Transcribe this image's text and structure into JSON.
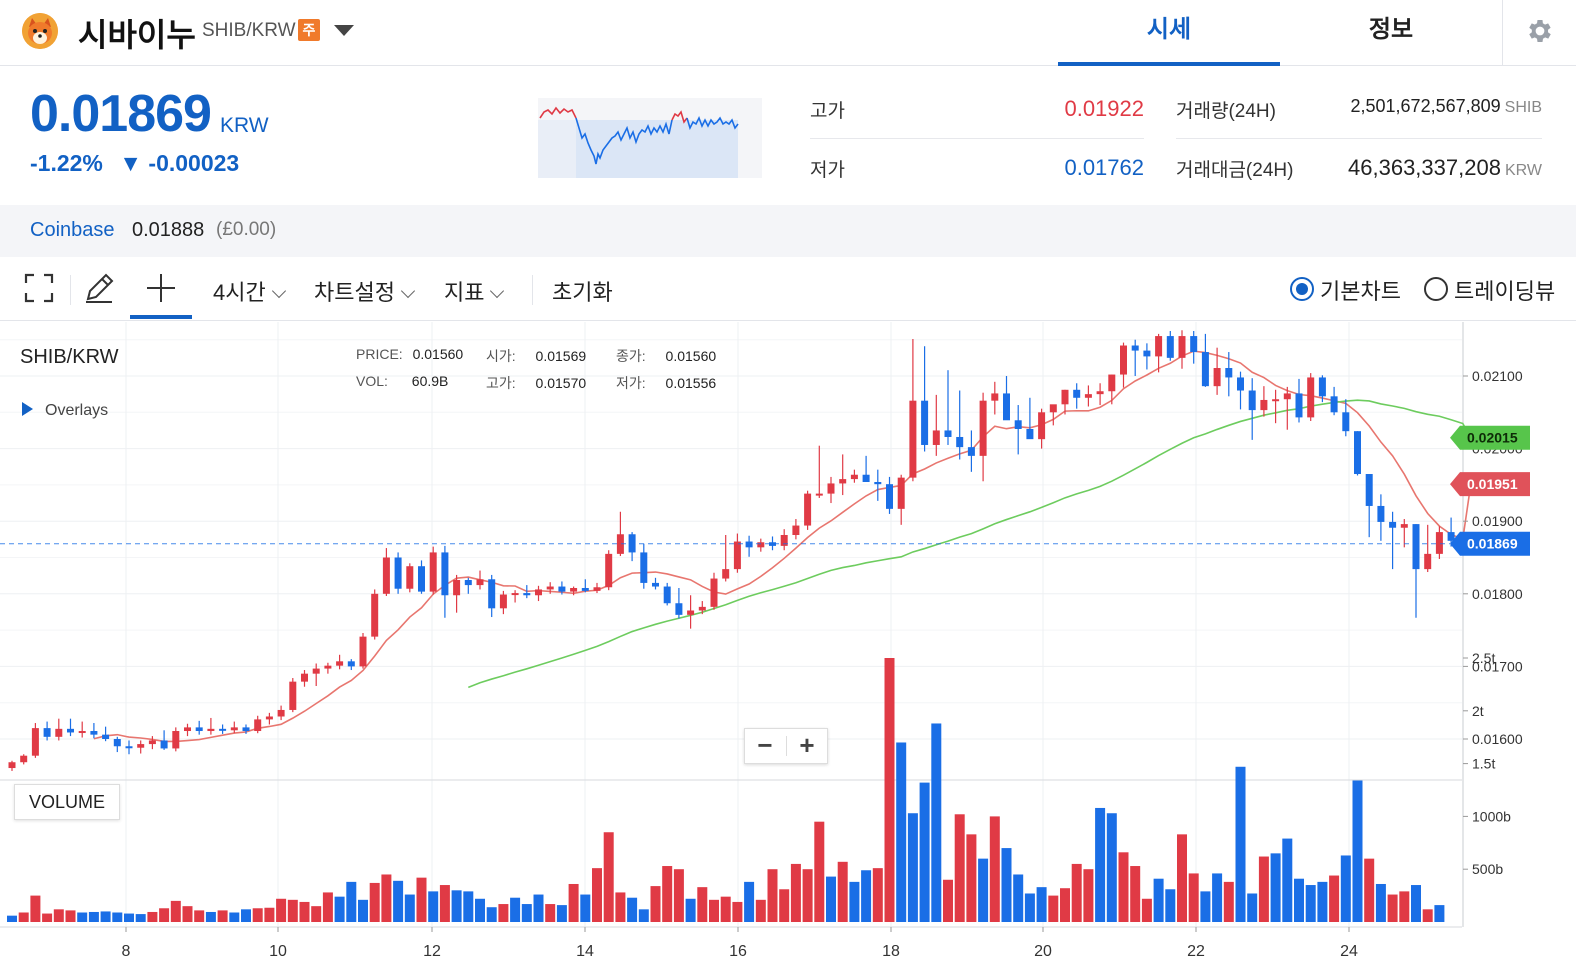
{
  "header": {
    "coin_name": "시바이누",
    "pair": "SHIB/KRW",
    "warning_badge": "주",
    "tabs": [
      {
        "label": "시세",
        "active": true
      },
      {
        "label": "정보",
        "active": false
      }
    ],
    "icons": {
      "logo": "shiba-inu-logo",
      "dropdown": "chevron-down-icon",
      "settings": "gear-icon"
    }
  },
  "summary": {
    "price": "0.01869",
    "unit": "KRW",
    "change_rate": "-1.22%",
    "change_arrow": "▼",
    "change_amount": "-0.00023",
    "high_label": "고가",
    "high_value": "0.01922",
    "low_label": "저가",
    "low_value": "0.01762",
    "volume_label": "거래량(24H)",
    "volume_value": "2,501,672,567,809",
    "volume_unit": "SHIB",
    "amount_label": "거래대금(24H)",
    "amount_value": "46,363,337,208",
    "amount_unit": "KRW"
  },
  "coinbase": {
    "label": "Coinbase",
    "value": "0.01888",
    "sub": "(£0.00)"
  },
  "toolbar": {
    "interval": "4시간",
    "chart_settings": "차트설정",
    "indicators": "지표",
    "reset": "초기화",
    "mode_basic": "기본차트",
    "mode_tradingview": "트레이딩뷰",
    "selected_mode": "기본차트",
    "icons": [
      "fullscreen-icon",
      "pencil-icon",
      "crosshair-icon"
    ]
  },
  "chart": {
    "symbol": "SHIB/KRW",
    "overlays_label": "Overlays",
    "ohlc": {
      "price_label": "PRICE:",
      "price": "0.01560",
      "open_label": "시가:",
      "open": "0.01569",
      "close_label": "종가:",
      "close": "0.01560",
      "vol_label": "VOL:",
      "vol": "60.9B",
      "high_label": "고가:",
      "high": "0.01570",
      "low_label": "저가:",
      "low": "0.01556"
    },
    "zoom_out": "−",
    "zoom_in": "+",
    "volume_label": "VOLUME",
    "colors": {
      "up": "#e03a45",
      "down": "#1a6ee6",
      "ma_short": "#e8766f",
      "ma_long": "#6dcc5e",
      "price_line": "#1a6ee6"
    }
  },
  "chart_data": {
    "type": "candlestick",
    "x_tick_labels": [
      "8",
      "10",
      "12",
      "14",
      "16",
      "18",
      "20",
      "22",
      "24"
    ],
    "y_tick_labels": [
      "0.02100",
      "0.02000",
      "0.01900",
      "0.01800",
      "0.01700",
      "0.01600"
    ],
    "volume_tick_labels": [
      "2.5t",
      "2t",
      "1.5t",
      "1000b",
      "500b"
    ],
    "price_markers": [
      {
        "label": "0.02015",
        "value": 0.02015,
        "color": "#57c54b"
      },
      {
        "label": "0.01951",
        "value": 0.01951,
        "color": "#e0525a"
      },
      {
        "label": "0.01869",
        "value": 0.01869,
        "color": "#1a6ee6"
      }
    ],
    "candles": [
      [
        0.0156,
        0.0157,
        0.01556,
        0.01568
      ],
      [
        0.01568,
        0.01579,
        0.01565,
        0.01577
      ],
      [
        0.01577,
        0.01622,
        0.01574,
        0.01615
      ],
      [
        0.01615,
        0.01624,
        0.01598,
        0.01603
      ],
      [
        0.01603,
        0.01628,
        0.01598,
        0.01614
      ],
      [
        0.01614,
        0.01628,
        0.01604,
        0.01609
      ],
      [
        0.01609,
        0.01624,
        0.01602,
        0.01611
      ],
      [
        0.01611,
        0.01622,
        0.01601,
        0.01606
      ],
      [
        0.01606,
        0.01617,
        0.01597,
        0.016
      ],
      [
        0.016,
        0.01603,
        0.01582,
        0.0159
      ],
      [
        0.0159,
        0.01598,
        0.01579,
        0.01588
      ],
      [
        0.01588,
        0.01598,
        0.0158,
        0.01593
      ],
      [
        0.01593,
        0.01604,
        0.01586,
        0.01598
      ],
      [
        0.01598,
        0.01612,
        0.01585,
        0.01587
      ],
      [
        0.01587,
        0.01616,
        0.01583,
        0.01611
      ],
      [
        0.01611,
        0.01621,
        0.01604,
        0.01616
      ],
      [
        0.01616,
        0.01625,
        0.01606,
        0.01611
      ],
      [
        0.01611,
        0.01629,
        0.01606,
        0.01614
      ],
      [
        0.01614,
        0.0162,
        0.01607,
        0.01612
      ],
      [
        0.01612,
        0.01624,
        0.01608,
        0.01616
      ],
      [
        0.01616,
        0.0162,
        0.01607,
        0.01611
      ],
      [
        0.01611,
        0.01632,
        0.01608,
        0.01627
      ],
      [
        0.01627,
        0.01636,
        0.0162,
        0.01631
      ],
      [
        0.01631,
        0.01646,
        0.01626,
        0.0164
      ],
      [
        0.0164,
        0.01684,
        0.01637,
        0.01679
      ],
      [
        0.01679,
        0.01695,
        0.01672,
        0.0169
      ],
      [
        0.0169,
        0.01704,
        0.01673,
        0.01697
      ],
      [
        0.01697,
        0.01705,
        0.0169,
        0.01701
      ],
      [
        0.01701,
        0.01716,
        0.01696,
        0.01707
      ],
      [
        0.01707,
        0.0171,
        0.01695,
        0.017
      ],
      [
        0.017,
        0.01746,
        0.01697,
        0.01741
      ],
      [
        0.01741,
        0.01806,
        0.01737,
        0.018
      ],
      [
        0.018,
        0.01863,
        0.01797,
        0.0185
      ],
      [
        0.0185,
        0.01857,
        0.018,
        0.01807
      ],
      [
        0.01807,
        0.01842,
        0.01802,
        0.01838
      ],
      [
        0.01838,
        0.01846,
        0.018,
        0.01803
      ],
      [
        0.01803,
        0.01865,
        0.01799,
        0.01857
      ],
      [
        0.01857,
        0.01866,
        0.01767,
        0.01798
      ],
      [
        0.01798,
        0.01826,
        0.01774,
        0.01819
      ],
      [
        0.01819,
        0.01822,
        0.018,
        0.01812
      ],
      [
        0.01812,
        0.01832,
        0.01806,
        0.0182
      ],
      [
        0.0182,
        0.01826,
        0.01768,
        0.0178
      ],
      [
        0.0178,
        0.01804,
        0.01772,
        0.01799
      ],
      [
        0.01799,
        0.01805,
        0.01788,
        0.01801
      ],
      [
        0.01801,
        0.01812,
        0.01794,
        0.01798
      ],
      [
        0.01798,
        0.01811,
        0.0179,
        0.01806
      ],
      [
        0.01806,
        0.01816,
        0.018,
        0.0181
      ],
      [
        0.0181,
        0.01817,
        0.01799,
        0.01803
      ],
      [
        0.01803,
        0.0181,
        0.01798,
        0.01808
      ],
      [
        0.01808,
        0.0182,
        0.01802,
        0.01804
      ],
      [
        0.01804,
        0.01815,
        0.01801,
        0.01809
      ],
      [
        0.01809,
        0.0186,
        0.01805,
        0.01855
      ],
      [
        0.01855,
        0.01913,
        0.01852,
        0.01882
      ],
      [
        0.01882,
        0.01885,
        0.01845,
        0.01857
      ],
      [
        0.01857,
        0.01869,
        0.01807,
        0.01815
      ],
      [
        0.01815,
        0.01822,
        0.01806,
        0.0181
      ],
      [
        0.0181,
        0.01815,
        0.01784,
        0.01787
      ],
      [
        0.01787,
        0.01808,
        0.01766,
        0.01771
      ],
      [
        0.01771,
        0.01798,
        0.01752,
        0.01777
      ],
      [
        0.01777,
        0.0179,
        0.01772,
        0.01782
      ],
      [
        0.01782,
        0.01829,
        0.01778,
        0.01821
      ],
      [
        0.01821,
        0.01881,
        0.01817,
        0.01834
      ],
      [
        0.01834,
        0.01883,
        0.01829,
        0.01872
      ],
      [
        0.01872,
        0.0188,
        0.01851,
        0.01864
      ],
      [
        0.01864,
        0.01876,
        0.01858,
        0.01871
      ],
      [
        0.01871,
        0.01879,
        0.0186,
        0.01866
      ],
      [
        0.01866,
        0.01889,
        0.0186,
        0.01881
      ],
      [
        0.01881,
        0.01903,
        0.01875,
        0.01894
      ],
      [
        0.01894,
        0.01942,
        0.01888,
        0.01938
      ],
      [
        0.01938,
        0.02004,
        0.01932,
        0.01938
      ],
      [
        0.01938,
        0.01961,
        0.01925,
        0.01952
      ],
      [
        0.01952,
        0.01992,
        0.01936,
        0.01958
      ],
      [
        0.01958,
        0.01971,
        0.01953,
        0.01964
      ],
      [
        0.01964,
        0.0199,
        0.01955,
        0.01954
      ],
      [
        0.01954,
        0.01971,
        0.01928,
        0.01951
      ],
      [
        0.01951,
        0.01961,
        0.0191,
        0.01917
      ],
      [
        0.01917,
        0.01964,
        0.01895,
        0.0196
      ],
      [
        0.0196,
        0.02151,
        0.01955,
        0.02066
      ],
      [
        0.02066,
        0.02141,
        0.01996,
        0.02005
      ],
      [
        0.02005,
        0.02074,
        0.0199,
        0.02025
      ],
      [
        0.02025,
        0.02108,
        0.02005,
        0.02016
      ],
      [
        0.02016,
        0.0208,
        0.01985,
        0.02002
      ],
      [
        0.02002,
        0.02025,
        0.01968,
        0.0199
      ],
      [
        0.0199,
        0.02077,
        0.01955,
        0.02066
      ],
      [
        0.02066,
        0.02092,
        0.02047,
        0.02076
      ],
      [
        0.02076,
        0.021,
        0.02055,
        0.02039
      ],
      [
        0.02039,
        0.0206,
        0.01992,
        0.02027
      ],
      [
        0.02027,
        0.0207,
        0.0202,
        0.02013
      ],
      [
        0.02013,
        0.02055,
        0.02,
        0.0205
      ],
      [
        0.0205,
        0.0206,
        0.02032,
        0.02061
      ],
      [
        0.02061,
        0.02081,
        0.02047,
        0.02081
      ],
      [
        0.02081,
        0.0209,
        0.02055,
        0.0207
      ],
      [
        0.0207,
        0.02087,
        0.02058,
        0.02075
      ],
      [
        0.02075,
        0.0209,
        0.0206,
        0.02079
      ],
      [
        0.02079,
        0.02102,
        0.02061,
        0.02102
      ],
      [
        0.02102,
        0.02146,
        0.02084,
        0.02142
      ],
      [
        0.02142,
        0.0215,
        0.021,
        0.02135
      ],
      [
        0.02135,
        0.02145,
        0.02109,
        0.02127
      ],
      [
        0.02127,
        0.02158,
        0.02105,
        0.02155
      ],
      [
        0.02155,
        0.02162,
        0.02121,
        0.02125
      ],
      [
        0.02125,
        0.02163,
        0.0211,
        0.02155
      ],
      [
        0.02155,
        0.02162,
        0.02117,
        0.02133
      ],
      [
        0.02133,
        0.02158,
        0.02085,
        0.02086
      ],
      [
        0.02086,
        0.02139,
        0.02074,
        0.02111
      ],
      [
        0.02111,
        0.02133,
        0.02072,
        0.02098
      ],
      [
        0.02098,
        0.02106,
        0.02054,
        0.0208
      ],
      [
        0.0208,
        0.02097,
        0.02012,
        0.02053
      ],
      [
        0.02053,
        0.02086,
        0.02044,
        0.02067
      ],
      [
        0.02067,
        0.02081,
        0.02035,
        0.02068
      ],
      [
        0.02068,
        0.02085,
        0.02026,
        0.02076
      ],
      [
        0.02076,
        0.02096,
        0.02036,
        0.02043
      ],
      [
        0.02043,
        0.02104,
        0.02038,
        0.02098
      ],
      [
        0.02098,
        0.02101,
        0.02064,
        0.02072
      ],
      [
        0.02072,
        0.02085,
        0.02046,
        0.0205
      ],
      [
        0.0205,
        0.02068,
        0.02017,
        0.02024
      ],
      [
        0.02024,
        0.02024,
        0.01963,
        0.01965
      ],
      [
        0.01965,
        0.01947,
        0.01878,
        0.01921
      ],
      [
        0.01921,
        0.01937,
        0.01873,
        0.01899
      ],
      [
        0.01899,
        0.01913,
        0.01834,
        0.01891
      ],
      [
        0.01891,
        0.01903,
        0.01864,
        0.01896
      ],
      [
        0.01896,
        0.01896,
        0.01767,
        0.01834
      ],
      [
        0.01834,
        0.01895,
        0.0183,
        0.01855
      ],
      [
        0.01855,
        0.01893,
        0.01848,
        0.01885
      ],
      [
        0.01885,
        0.01905,
        0.01865,
        0.01873
      ],
      [
        0.01873,
        0.01885,
        0.01862,
        0.01869
      ]
    ],
    "volume": [
      [
        60,
        0
      ],
      [
        90,
        1
      ],
      [
        250,
        1
      ],
      [
        80,
        1
      ],
      [
        120,
        1
      ],
      [
        110,
        1
      ],
      [
        90,
        0
      ],
      [
        95,
        0
      ],
      [
        100,
        0
      ],
      [
        90,
        0
      ],
      [
        80,
        0
      ],
      [
        75,
        0
      ],
      [
        95,
        1
      ],
      [
        130,
        1
      ],
      [
        200,
        1
      ],
      [
        150,
        1
      ],
      [
        110,
        1
      ],
      [
        95,
        0
      ],
      [
        110,
        1
      ],
      [
        90,
        0
      ],
      [
        120,
        0
      ],
      [
        130,
        1
      ],
      [
        135,
        1
      ],
      [
        220,
        1
      ],
      [
        210,
        1
      ],
      [
        190,
        1
      ],
      [
        150,
        1
      ],
      [
        280,
        1
      ],
      [
        240,
        0
      ],
      [
        380,
        0
      ],
      [
        210,
        0
      ],
      [
        370,
        1
      ],
      [
        450,
        1
      ],
      [
        390,
        0
      ],
      [
        260,
        0
      ],
      [
        420,
        1
      ],
      [
        290,
        0
      ],
      [
        350,
        1
      ],
      [
        300,
        0
      ],
      [
        290,
        0
      ],
      [
        220,
        0
      ],
      [
        140,
        0
      ],
      [
        170,
        1
      ],
      [
        230,
        0
      ],
      [
        170,
        0
      ],
      [
        260,
        0
      ],
      [
        170,
        1
      ],
      [
        160,
        0
      ],
      [
        360,
        1
      ],
      [
        260,
        0
      ],
      [
        510,
        1
      ],
      [
        850,
        1
      ],
      [
        280,
        1
      ],
      [
        230,
        0
      ],
      [
        120,
        0
      ],
      [
        340,
        1
      ],
      [
        530,
        1
      ],
      [
        500,
        1
      ],
      [
        220,
        0
      ],
      [
        330,
        1
      ],
      [
        210,
        1
      ],
      [
        240,
        1
      ],
      [
        190,
        1
      ],
      [
        380,
        0
      ],
      [
        210,
        1
      ],
      [
        500,
        1
      ],
      [
        310,
        1
      ],
      [
        550,
        1
      ],
      [
        500,
        1
      ],
      [
        950,
        1
      ],
      [
        430,
        0
      ],
      [
        570,
        1
      ],
      [
        380,
        0
      ],
      [
        490,
        0
      ],
      [
        510,
        1
      ],
      [
        2500,
        1
      ],
      [
        1700,
        0
      ],
      [
        1030,
        0
      ],
      [
        1320,
        0
      ],
      [
        1880,
        0
      ],
      [
        400,
        1
      ],
      [
        1020,
        1
      ],
      [
        830,
        1
      ],
      [
        600,
        0
      ],
      [
        1000,
        1
      ],
      [
        700,
        0
      ],
      [
        450,
        0
      ],
      [
        270,
        0
      ],
      [
        330,
        0
      ],
      [
        250,
        1
      ],
      [
        320,
        1
      ],
      [
        550,
        1
      ],
      [
        500,
        1
      ],
      [
        1080,
        0
      ],
      [
        1030,
        0
      ],
      [
        660,
        1
      ],
      [
        530,
        1
      ],
      [
        220,
        1
      ],
      [
        410,
        0
      ],
      [
        310,
        0
      ],
      [
        830,
        1
      ],
      [
        460,
        1
      ],
      [
        290,
        0
      ],
      [
        460,
        0
      ],
      [
        380,
        1
      ],
      [
        1470,
        0
      ],
      [
        270,
        0
      ],
      [
        620,
        1
      ],
      [
        650,
        0
      ],
      [
        790,
        0
      ],
      [
        410,
        0
      ],
      [
        350,
        0
      ],
      [
        380,
        0
      ],
      [
        440,
        1
      ],
      [
        630,
        0
      ],
      [
        1340,
        0
      ],
      [
        600,
        1
      ],
      [
        360,
        0
      ],
      [
        260,
        1
      ],
      [
        290,
        1
      ],
      [
        350,
        0
      ],
      [
        120,
        1
      ],
      [
        160,
        0
      ]
    ]
  }
}
